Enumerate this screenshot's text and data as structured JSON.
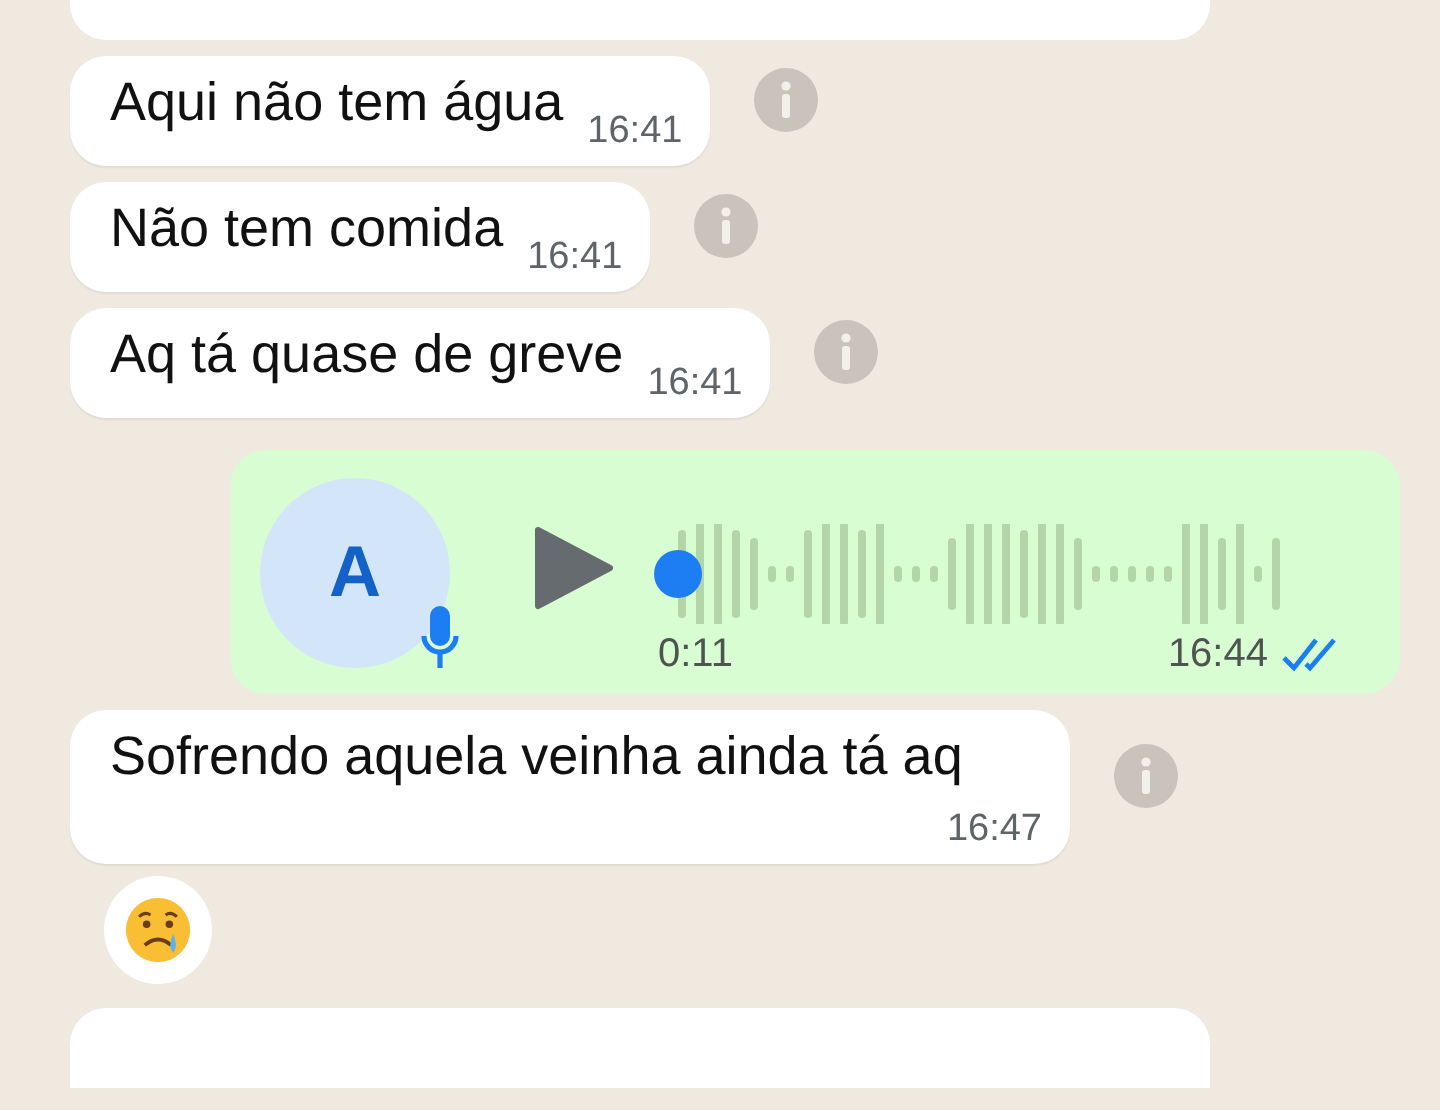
{
  "messages": [
    {
      "kind": "text",
      "text": "Aqui não tem água",
      "time": "16:41"
    },
    {
      "kind": "text",
      "text": "Não tem comida",
      "time": "16:41"
    },
    {
      "kind": "text",
      "text": "Aq tá quase de greve",
      "time": "16:41"
    },
    {
      "kind": "audio",
      "avatar": "A",
      "duration": "0:11",
      "time": "16:44",
      "read": true
    },
    {
      "kind": "text",
      "text": "Sofrendo aquela veinha ainda tá aq",
      "time": "16:47"
    },
    {
      "kind": "emoji"
    }
  ]
}
